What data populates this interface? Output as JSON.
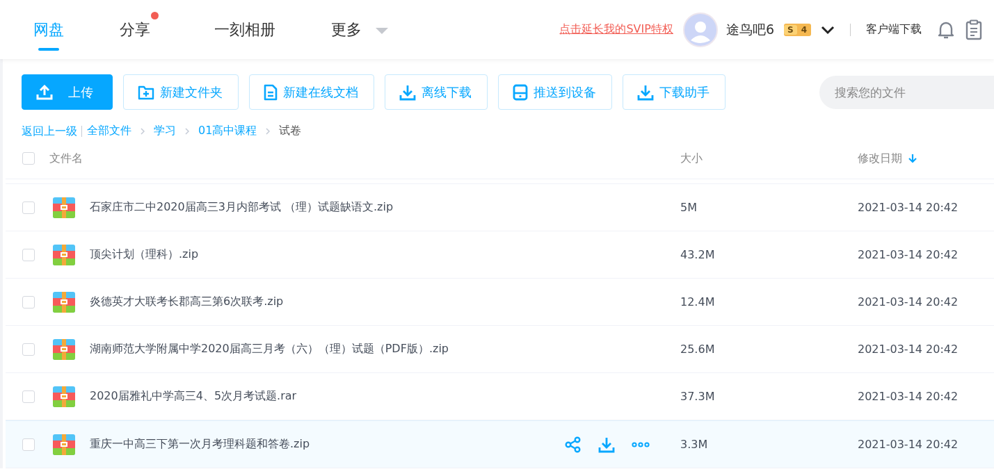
{
  "nav": {
    "tabs": [
      {
        "label": "网盘",
        "selected": true,
        "dot": false,
        "dropdown": false
      },
      {
        "label": "分享",
        "selected": false,
        "dot": true,
        "dropdown": false
      },
      {
        "label": "一刻相册",
        "selected": false,
        "dot": false,
        "dropdown": false
      },
      {
        "label": "更多",
        "selected": false,
        "dot": false,
        "dropdown": true
      }
    ],
    "promo_link": "点击延长我的SVIP特权",
    "username": "途鸟吧6",
    "vip_badge": {
      "letter": "S",
      "level": "4"
    },
    "client_download": "客户端下载"
  },
  "toolbar": {
    "buttons": [
      {
        "label": "上传",
        "kind": "upload"
      },
      {
        "label": "新建文件夹",
        "kind": "folder"
      },
      {
        "label": "新建在线文档",
        "kind": "doc"
      },
      {
        "label": "离线下载",
        "kind": "download"
      },
      {
        "label": "推送到设备",
        "kind": "device"
      },
      {
        "label": "下载助手",
        "kind": "download"
      }
    ],
    "search": {
      "placeholder": "搜索您的文件"
    }
  },
  "breadcrumb": {
    "back": "返回上一级",
    "path": [
      "全部文件",
      "学习",
      "01高中课程"
    ],
    "current": "试卷"
  },
  "table": {
    "columns": [
      "文件名",
      "大小",
      "修改日期"
    ],
    "all_checked": false,
    "rows": [
      {
        "name": "石家庄市二中2020届高三3月内部考试 （理）试题缺语文.zip",
        "size": "5M",
        "date": "2021-03-14 20:42",
        "checked": false,
        "hovered": false
      },
      {
        "name": "顶尖计划（理科）.zip",
        "size": "43.2M",
        "date": "2021-03-14 20:42",
        "checked": false,
        "hovered": false
      },
      {
        "name": "炎德英才大联考长郡高三第6次联考.zip",
        "size": "12.4M",
        "date": "2021-03-14 20:42",
        "checked": false,
        "hovered": false
      },
      {
        "name": "湖南师范大学附属中学2020届高三月考（六）（理）试题（PDF版）.zip",
        "size": "25.6M",
        "date": "2021-03-14 20:42",
        "checked": false,
        "hovered": false
      },
      {
        "name": "2020届雅礼中学高三4、5次月考试题.rar",
        "size": "37.3M",
        "date": "2021-03-14 20:42",
        "checked": false,
        "hovered": false
      },
      {
        "name": "重庆一中高三下第一次月考理科题和答卷.zip",
        "size": "3.3M",
        "date": "2021-03-14 20:42",
        "checked": false,
        "hovered": true
      }
    ]
  }
}
